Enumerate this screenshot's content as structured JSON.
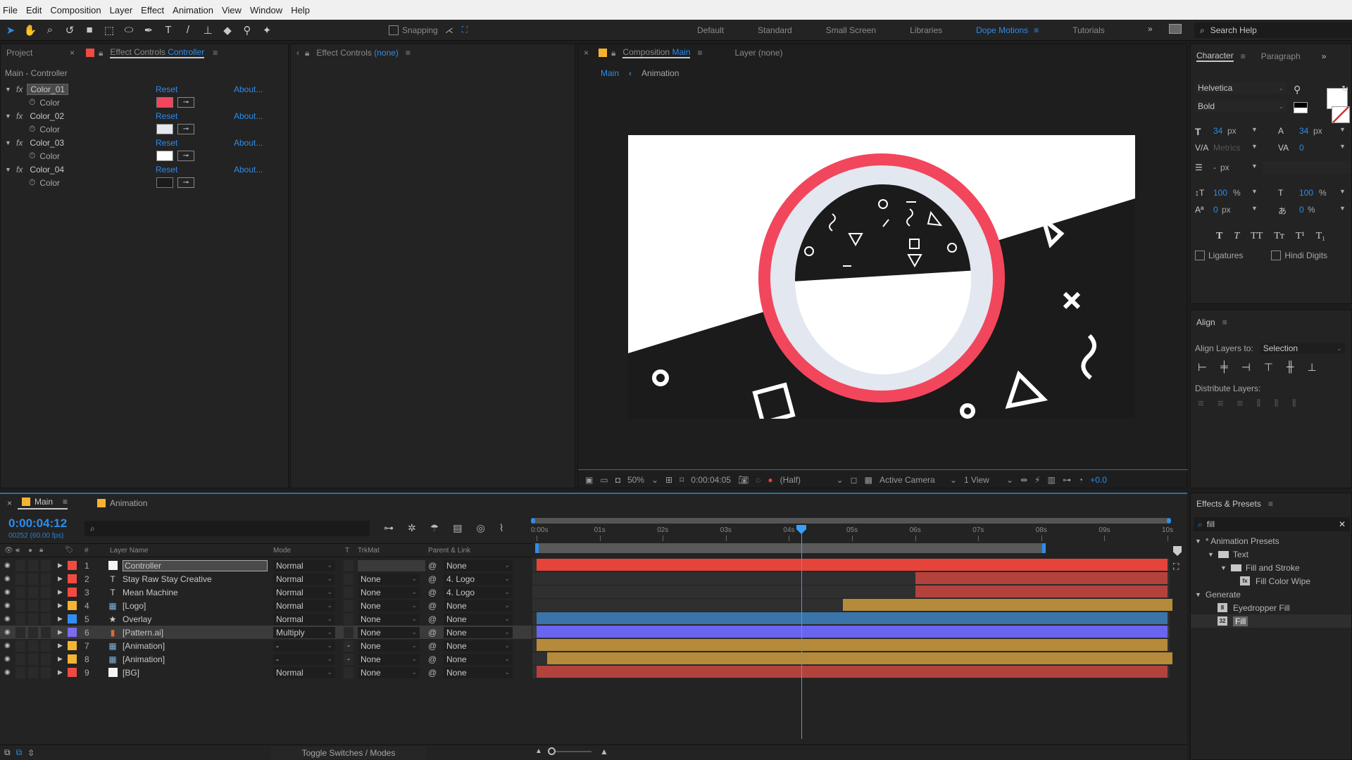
{
  "menubar": [
    "File",
    "Edit",
    "Composition",
    "Layer",
    "Effect",
    "Animation",
    "View",
    "Window",
    "Help"
  ],
  "toolbar": {
    "tools": [
      {
        "name": "selection-tool",
        "glyph": "➤",
        "active": true
      },
      {
        "name": "hand-tool",
        "glyph": "✋"
      },
      {
        "name": "zoom-tool",
        "glyph": "⌕"
      },
      {
        "name": "rotate-tool",
        "glyph": "↺"
      },
      {
        "name": "camera-tool",
        "glyph": "■"
      },
      {
        "name": "pan-behind-tool",
        "glyph": "⬚"
      },
      {
        "name": "ellipse-tool",
        "glyph": "⬭"
      },
      {
        "name": "pen-tool",
        "glyph": "✒"
      },
      {
        "name": "type-tool",
        "glyph": "T"
      },
      {
        "name": "brush-tool",
        "glyph": "/"
      },
      {
        "name": "clone-stamp-tool",
        "glyph": "⊥"
      },
      {
        "name": "eraser-tool",
        "glyph": "◆"
      },
      {
        "name": "roto-brush-tool",
        "glyph": "⚲"
      },
      {
        "name": "puppet-tool",
        "glyph": "✦"
      }
    ],
    "snapping_label": "Snapping",
    "workspaces": [
      "Default",
      "Standard",
      "Small Screen",
      "Libraries",
      "Dope Motions",
      "Tutorials"
    ],
    "active_workspace": "Dope Motions",
    "overflow": "»",
    "search_help": "Search Help"
  },
  "effect_controls": {
    "tab_project": "Project",
    "tab_label": "Effect Controls",
    "tab_target": "Controller",
    "title": "Main - Controller",
    "effects": [
      {
        "name": "Color_01",
        "property": "Color",
        "color": "#f2465c",
        "reset": "Reset",
        "about": "About..."
      },
      {
        "name": "Color_02",
        "property": "Color",
        "color": "#e6e8f0",
        "reset": "Reset",
        "about": "About..."
      },
      {
        "name": "Color_03",
        "property": "Color",
        "color": "#ffffff",
        "reset": "Reset",
        "about": "About..."
      },
      {
        "name": "Color_04",
        "property": "Color",
        "color": "#1b1b1b",
        "reset": "Reset",
        "about": "About..."
      }
    ]
  },
  "effect_controls_none": {
    "tab_label": "Effect Controls",
    "tab_target": "(none)"
  },
  "composition": {
    "tab_label": "Composition",
    "tab_target": "Main",
    "layer_tab": "Layer  (none)",
    "breadcrumb": [
      "Main",
      "Animation"
    ],
    "toolbar": {
      "zoom": "50%",
      "timecode": "0:00:04:05",
      "resolution": "(Half)",
      "camera": "Active Camera",
      "views": "1 View",
      "exposure": "+0.0"
    },
    "colors": {
      "ring": "#f2465c",
      "inner_ring": "#e3e7f0",
      "dark": "#1b1b1b",
      "white": "#ffffff"
    }
  },
  "character": {
    "tab": "Character",
    "tab2": "Paragraph",
    "font": "Helvetica",
    "style": "Bold",
    "font_size": "34",
    "leading": "34",
    "unit": "px",
    "kerning": "Metrics",
    "tracking": "0",
    "stroke_width": "-",
    "vertical_scale": "100",
    "horizontal_scale": "100",
    "baseline_shift": "0",
    "tsume": "0",
    "style_buttons": [
      "T",
      "T",
      "TT",
      "Tт",
      "T¹",
      "T₁"
    ],
    "ligatures": "Ligatures",
    "hindi_digits": "Hindi Digits"
  },
  "align": {
    "title": "Align",
    "align_to_label": "Align Layers to:",
    "align_to_value": "Selection",
    "distribute_label": "Distribute Layers:"
  },
  "effects_presets": {
    "title": "Effects & Presets",
    "search_value": "fill",
    "tree": [
      {
        "label": "* Animation Presets",
        "level": 0,
        "type": "group"
      },
      {
        "label": "Text",
        "level": 1,
        "type": "folder"
      },
      {
        "label": "Fill and Stroke",
        "level": 2,
        "type": "folder"
      },
      {
        "label": "Fill Color Wipe",
        "level": 3,
        "type": "preset",
        "badge": "fx"
      },
      {
        "label": "Generate",
        "level": 0,
        "type": "group"
      },
      {
        "label": "Eyedropper Fill",
        "level": 1,
        "type": "effect",
        "badge": "8"
      },
      {
        "label": "Fill",
        "level": 1,
        "type": "effect",
        "badge": "32",
        "selected": true
      }
    ]
  },
  "timeline": {
    "tabs": [
      {
        "label": "Main",
        "active": true
      },
      {
        "label": "Animation",
        "active": false
      }
    ],
    "timecode": "0:00:04:12",
    "frame_info": "00252 (60.00 fps)",
    "columns": {
      "num": "#",
      "layer_name": "Layer Name",
      "mode": "Mode",
      "t": "T",
      "trkmat": "TrkMat",
      "parent": "Parent & Link"
    },
    "ruler": [
      "0:00s",
      "01s",
      "02s",
      "03s",
      "04s",
      "05s",
      "06s",
      "07s",
      "08s",
      "09s",
      "10s"
    ],
    "duration_seconds": 10,
    "current_time_seconds": 4.2,
    "work_area_end_seconds": 8.05,
    "layers": [
      {
        "num": "1",
        "name": "Controller",
        "type": "solid",
        "label_color": "#ef4b42",
        "mode": "Normal",
        "t": "",
        "trkmat": "",
        "parent": "None",
        "bar_color": "#e6443a",
        "bar_start": 0,
        "bar_end": 10,
        "selected_name": true
      },
      {
        "num": "2",
        "name": "Stay Raw Stay Creative",
        "type": "text",
        "label_color": "#ef4b42",
        "mode": "Normal",
        "t": "",
        "trkmat": "None",
        "parent": "4. Logo",
        "bar_color": "#b3423c",
        "bar_start": 6.0,
        "bar_end": 10
      },
      {
        "num": "3",
        "name": "Mean Machine",
        "type": "text",
        "label_color": "#ef4b42",
        "mode": "Normal",
        "t": "",
        "trkmat": "None",
        "parent": "4. Logo",
        "bar_color": "#b3423c",
        "bar_start": 6.0,
        "bar_end": 10
      },
      {
        "num": "4",
        "name": "[Logo]",
        "type": "comp",
        "label_color": "#f5b430",
        "mode": "Normal",
        "t": "",
        "trkmat": "None",
        "parent": "None",
        "bar_color": "#b58a3a",
        "bar_start": 4.85,
        "bar_end": 10.08
      },
      {
        "num": "5",
        "name": "Overlay",
        "type": "shape",
        "label_color": "#2f8ff0",
        "mode": "Normal",
        "t": "",
        "trkmat": "None",
        "parent": "None",
        "bar_color": "#3a74a8",
        "bar_start": 0,
        "bar_end": 10
      },
      {
        "num": "6",
        "name": "[Pattern.ai]",
        "type": "ai",
        "label_color": "#7b6cf0",
        "mode": "Multiply",
        "t": "",
        "trkmat": "None",
        "parent": "None",
        "bar_color": "#6a65ee",
        "bar_start": 0,
        "bar_end": 10,
        "selected": true
      },
      {
        "num": "7",
        "name": "[Animation]",
        "type": "comp",
        "label_color": "#f5b430",
        "mode": "-",
        "t": "-",
        "trkmat": "None",
        "parent": "None",
        "bar_color": "#b58a3a",
        "bar_start": 0,
        "bar_end": 10
      },
      {
        "num": "8",
        "name": "[Animation]",
        "type": "comp",
        "label_color": "#f5b430",
        "mode": "-",
        "t": "-",
        "trkmat": "None",
        "parent": "None",
        "bar_color": "#b58a3a",
        "bar_start": 0.17,
        "bar_end": 10.08
      },
      {
        "num": "9",
        "name": "[BG]",
        "type": "solid",
        "label_color": "#ef4b42",
        "mode": "Normal",
        "t": "",
        "trkmat": "None",
        "parent": "None",
        "bar_color": "#b3423c",
        "bar_start": 0,
        "bar_end": 10
      }
    ],
    "toggle_label": "Toggle Switches / Modes"
  },
  "accent": "#2d8ceb"
}
